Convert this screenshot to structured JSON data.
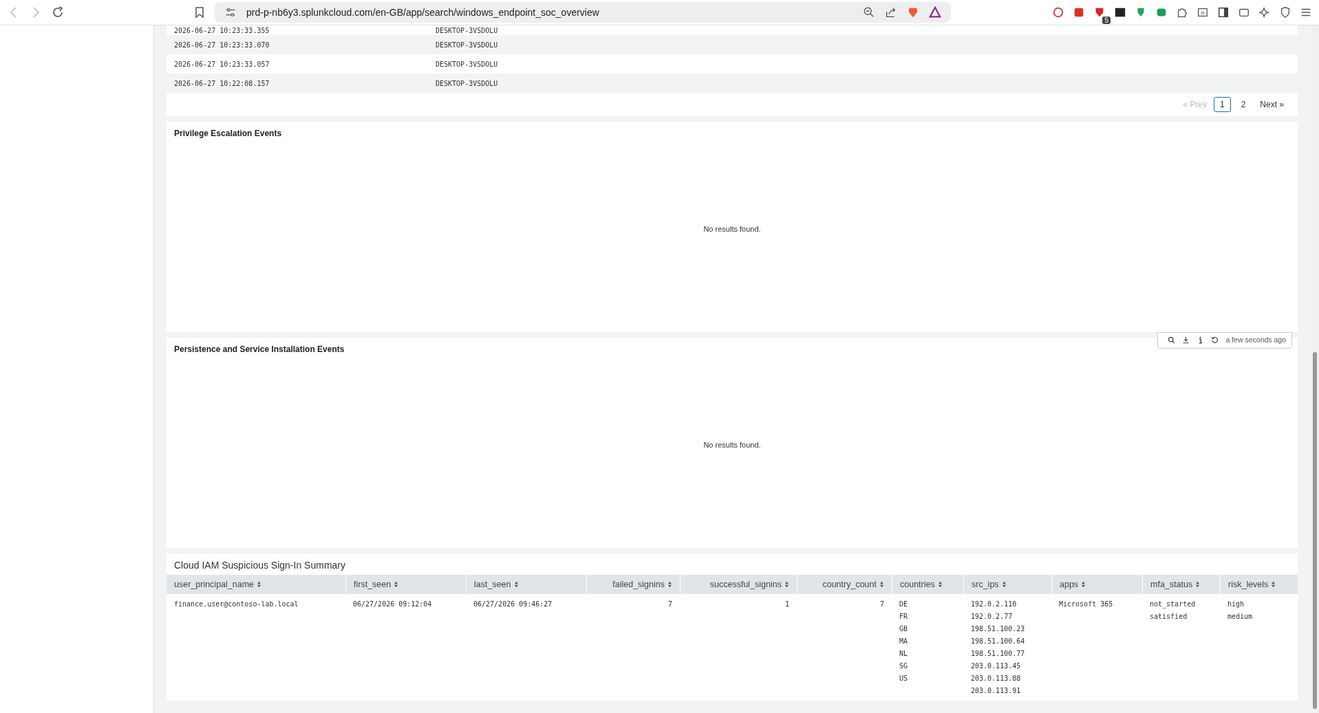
{
  "browser": {
    "url": "prd-p-nb6y3.splunkcloud.com/en-GB/app/search/windows_endpoint_soc_overview",
    "extension_badge": "5"
  },
  "events_table": {
    "rows": [
      {
        "time": "2026-06-27 10:23:33.355",
        "host": "DESKTOP-3VSDOLU"
      },
      {
        "time": "2026-06-27 10:23:33.070",
        "host": "DESKTOP-3VSDOLU"
      },
      {
        "time": "2026-06-27 10:23:33.057",
        "host": "DESKTOP-3VSDOLU"
      },
      {
        "time": "2026-06-27 10:22:08.157",
        "host": "DESKTOP-3VSDOLU"
      }
    ],
    "pagination": {
      "prev": "« Prev",
      "pages": [
        {
          "label": "1",
          "selected": true
        },
        {
          "label": "2",
          "selected": false
        }
      ],
      "next": "Next »"
    }
  },
  "privilege_panel": {
    "title": "Privilege Escalation Events",
    "message": "No results found."
  },
  "persistence_panel": {
    "title": "Persistence and Service Installation Events",
    "message": "No results found.",
    "toolbar": {
      "status": "a few seconds ago"
    }
  },
  "cloud_iam": {
    "title": "Cloud IAM Suspicious Sign-In Summary",
    "columns": [
      {
        "label": "user_principal_name",
        "kind": "text"
      },
      {
        "label": "first_seen",
        "kind": "text"
      },
      {
        "label": "last_seen",
        "kind": "text"
      },
      {
        "label": "failed_signins",
        "kind": "number"
      },
      {
        "label": "successful_signins",
        "kind": "number"
      },
      {
        "label": "country_count",
        "kind": "number"
      },
      {
        "label": "countries",
        "kind": "text"
      },
      {
        "label": "src_ips",
        "kind": "text"
      },
      {
        "label": "apps",
        "kind": "text"
      },
      {
        "label": "mfa_status",
        "kind": "text"
      },
      {
        "label": "risk_levels",
        "kind": "text"
      }
    ],
    "rows": [
      {
        "cells": [
          [
            "finance.user@contoso-lab.local"
          ],
          [
            "06/27/2026 09:12:04"
          ],
          [
            "06/27/2026 09:46:27"
          ],
          [
            "7"
          ],
          [
            "1"
          ],
          [
            "7"
          ],
          [
            "DE",
            "FR",
            "GB",
            "MA",
            "NL",
            "SG",
            "US"
          ],
          [
            "192.0.2.110",
            "192.0.2.77",
            "198.51.100.23",
            "198.51.100.64",
            "198.51.100.77",
            "203.0.113.45",
            "203.0.113.88",
            "203.0.113.91"
          ],
          [
            "Microsoft 365"
          ],
          [
            "not_started",
            "satisfied"
          ],
          [
            "high",
            "medium"
          ]
        ]
      }
    ]
  }
}
